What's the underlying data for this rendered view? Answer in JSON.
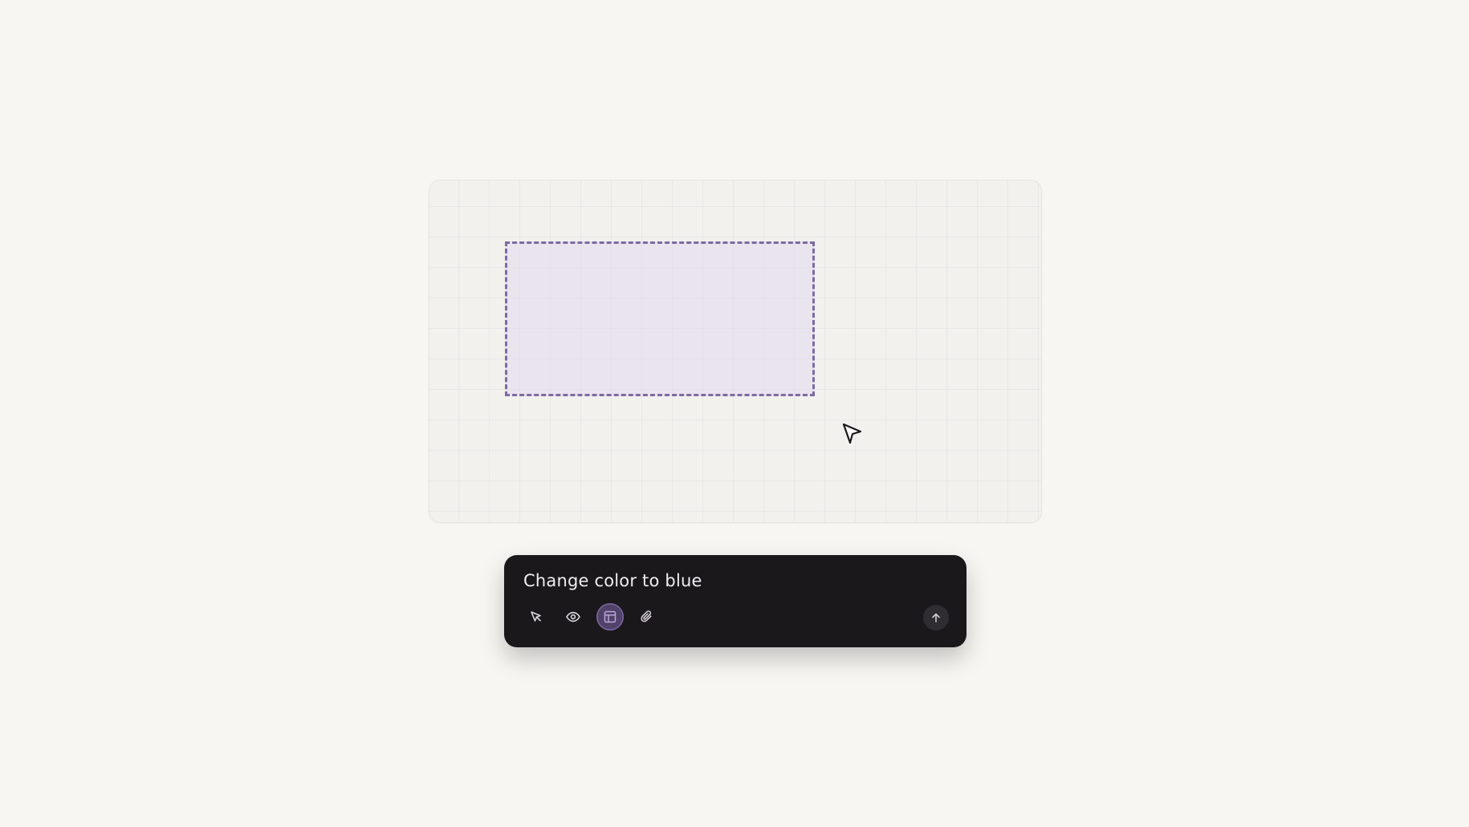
{
  "prompt": {
    "text": "Change color to blue"
  },
  "toolbar": {
    "tools": [
      {
        "icon": "cursor-select-icon",
        "active": false
      },
      {
        "icon": "eye-icon",
        "active": false
      },
      {
        "icon": "layout-icon",
        "active": true
      },
      {
        "icon": "paperclip-icon",
        "active": false
      }
    ],
    "send_icon": "arrow-up-icon"
  },
  "colors": {
    "background": "#f8f6f2",
    "selection_border": "#7d6aa6",
    "selection_fill": "#e2d8ec",
    "prompt_bg": "#1a181b",
    "active_tool": "#51426a"
  }
}
